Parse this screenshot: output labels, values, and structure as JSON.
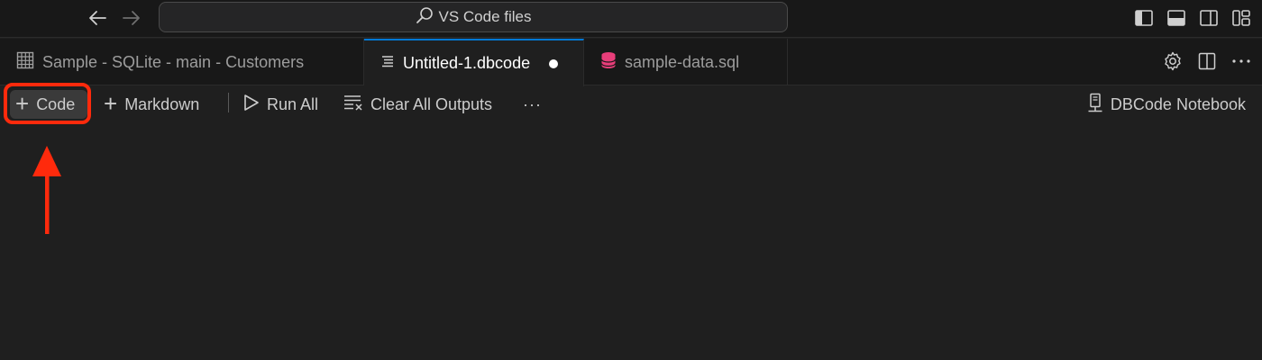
{
  "titlebar": {
    "command_center": "VS Code files"
  },
  "tabs": [
    {
      "label": "Sample - SQLite - main - Customers",
      "icon": "table-grid-icon",
      "active": false
    },
    {
      "label": "Untitled-1.dbcode",
      "icon": "notebook-file-icon",
      "active": true,
      "modified": true
    },
    {
      "label": "sample-data.sql",
      "icon": "database-icon",
      "active": false
    }
  ],
  "toolbar": {
    "add_code": "Code",
    "add_markdown": "Markdown",
    "run_all": "Run All",
    "clear_outputs": "Clear All Outputs",
    "more": "···",
    "kernel": "DBCode Notebook"
  },
  "colors": {
    "accent": "#0078d4",
    "highlight": "#ff2a0c",
    "sql_icon": "#e83e7a"
  }
}
